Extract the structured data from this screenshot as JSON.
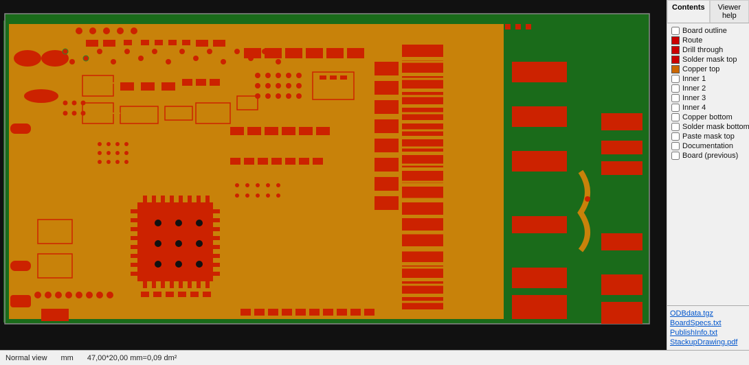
{
  "tabs": {
    "contents": "Contents",
    "viewer_help": "Viewer help"
  },
  "layers": [
    {
      "id": "board-outline",
      "label": "Board outline",
      "checked": false,
      "color": null
    },
    {
      "id": "route",
      "label": "Route",
      "checked": true,
      "color": "#cc0000"
    },
    {
      "id": "drill-through",
      "label": "Drill through",
      "checked": true,
      "color": "#cc0000"
    },
    {
      "id": "solder-mask-top",
      "label": "Solder mask top",
      "checked": true,
      "color": "#cc0000"
    },
    {
      "id": "copper-top",
      "label": "Copper top",
      "checked": true,
      "color": "#cc6600"
    },
    {
      "id": "inner-1",
      "label": "Inner 1",
      "checked": false,
      "color": null
    },
    {
      "id": "inner-2",
      "label": "Inner 2",
      "checked": false,
      "color": null
    },
    {
      "id": "inner-3",
      "label": "Inner 3",
      "checked": false,
      "color": null
    },
    {
      "id": "inner-4",
      "label": "Inner 4",
      "checked": false,
      "color": null
    },
    {
      "id": "copper-bottom",
      "label": "Copper bottom",
      "checked": false,
      "color": null
    },
    {
      "id": "solder-mask-bottom",
      "label": "Solder mask bottom",
      "checked": false,
      "color": null
    },
    {
      "id": "paste-mask-top",
      "label": "Paste mask top",
      "checked": false,
      "color": null
    },
    {
      "id": "documentation",
      "label": "Documentation",
      "checked": false,
      "color": null
    },
    {
      "id": "board-previous",
      "label": "Board (previous)",
      "checked": false,
      "color": null
    }
  ],
  "files": [
    {
      "label": "ODBdata.tgz"
    },
    {
      "label": "BoardSpecs.txt"
    },
    {
      "label": "PublishInfo.txt"
    },
    {
      "label": "StackupDrawing.pdf"
    }
  ],
  "status": {
    "view_mode": "Normal view",
    "units": "mm",
    "coordinates": "47,00*20,00 mm=0,09 dm²"
  }
}
